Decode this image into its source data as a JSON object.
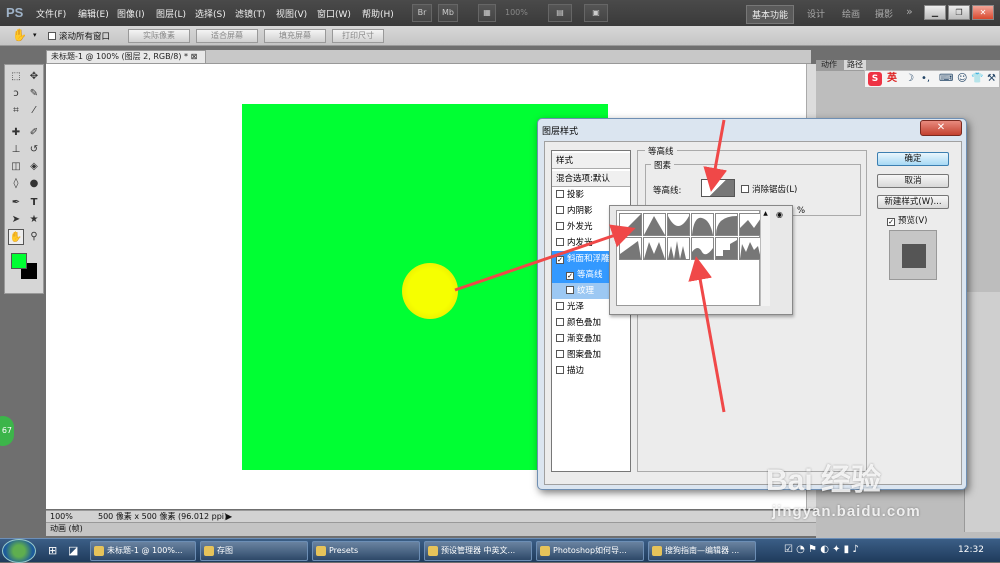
{
  "app": {
    "logo": "PS"
  },
  "menu": [
    "文件(F)",
    "编辑(E)",
    "图像(I)",
    "图层(L)",
    "选择(S)",
    "滤镜(T)",
    "视图(V)",
    "窗口(W)",
    "帮助(H)"
  ],
  "toolbar": {
    "zoom": "100%"
  },
  "workspaces": [
    "基本功能",
    "设计",
    "绘画",
    "摄影"
  ],
  "more": "»",
  "options": {
    "scroll_all": "滚动所有窗口",
    "actual_pixels": "实际像素",
    "fit_screen": "适合屏幕",
    "fill_screen": "填充屏幕",
    "print_size": "打印尺寸"
  },
  "document": {
    "tab": "未标题-1 @ 100% (图层 2, RGB/8) *",
    "zoom": "100%",
    "size": "500 像素 x 500 像素 (96.012 ppi)",
    "anim_panel": "动画 (帧)"
  },
  "right_panel": {
    "tabs": [
      "动作",
      "路径"
    ],
    "ime_label": "英"
  },
  "dialog": {
    "title": "图层样式",
    "close": "✕",
    "styles_header": "样式",
    "blend_default": "混合选项:默认",
    "items": [
      {
        "label": "投影",
        "checked": false
      },
      {
        "label": "内阴影",
        "checked": false
      },
      {
        "label": "外发光",
        "checked": false
      },
      {
        "label": "内发光",
        "checked": false
      },
      {
        "label": "斜面和浮雕",
        "checked": true
      },
      {
        "label": "等高线",
        "checked": true
      },
      {
        "label": "纹理",
        "checked": false
      },
      {
        "label": "光泽",
        "checked": false
      },
      {
        "label": "颜色叠加",
        "checked": false
      },
      {
        "label": "渐变叠加",
        "checked": false
      },
      {
        "label": "图案叠加",
        "checked": false
      },
      {
        "label": "描边",
        "checked": false
      }
    ],
    "group_contour": "等高线",
    "group_element": "图素",
    "contour_label": "等高线:",
    "antialias": "消除锯齿(L)",
    "percent_sign": "%",
    "ok": "确定",
    "cancel": "取消",
    "new_style": "新建样式(W)...",
    "preview": "预览(V)"
  },
  "taskbar": {
    "items": [
      "未标题-1 @ 100%...",
      "存图",
      "Presets",
      "预设管理器 中英文...",
      "Photoshop如何导...",
      "搜狗指南—编辑器 ..."
    ],
    "clock": "12:32"
  },
  "watermark": {
    "main": "Bai 经验",
    "sub": "jingyan.baidu.com"
  },
  "badge": "67",
  "colors": {
    "canvas": "#00ff33",
    "circle": "#f6ff00",
    "arrow": "#f04848"
  }
}
